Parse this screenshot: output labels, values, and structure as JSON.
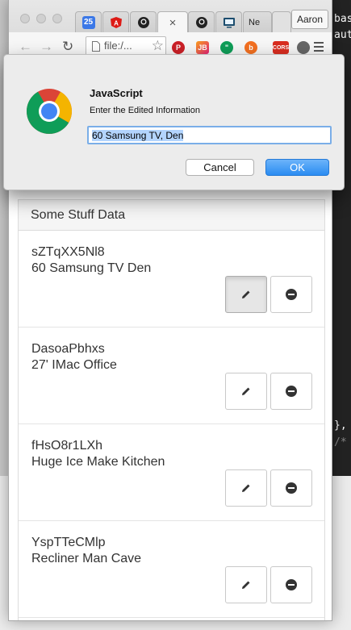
{
  "browser": {
    "profile": "Aaron",
    "url": "file:/...",
    "tabs": [
      {
        "label": "25"
      },
      {
        "label": ""
      },
      {
        "label": ""
      },
      {
        "label": "×"
      },
      {
        "label": ""
      },
      {
        "label": ""
      },
      {
        "label": "Ne"
      }
    ],
    "extensions": [
      "pinterest-icon",
      "jetbrains-icon",
      "hangouts-icon",
      "b-icon",
      "cors-icon",
      "half-circle-icon",
      "menu-icon"
    ],
    "extension_labels": {
      "cors": "CORS"
    }
  },
  "panel": {
    "heading": "Some Stuff Data",
    "items": [
      {
        "id": "sZTqXX5Nl8",
        "desc": "60 Samsung TV Den"
      },
      {
        "id": "DasoaPbhxs",
        "desc": "27' IMac Office"
      },
      {
        "id": "fHsO8r1LXh",
        "desc": "Huge Ice Make Kitchen"
      },
      {
        "id": "YspTTeCMlp",
        "desc": "Recliner Man Cave"
      }
    ]
  },
  "dialog": {
    "title": "JavaScript",
    "message": "Enter the Edited Information",
    "input_value": "60 Samsung TV, Den",
    "cancel_label": "Cancel",
    "ok_label": "OK"
  },
  "editor": {
    "lines": [
      "bas",
      "aut",
      "},",
      "/*"
    ]
  },
  "colors": {
    "accent_blue": "#2a8cf1",
    "selection": "#b3d4fd"
  }
}
